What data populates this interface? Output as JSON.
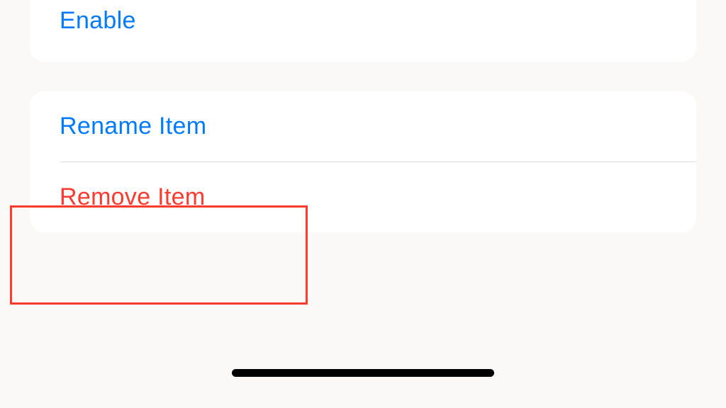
{
  "section1": {
    "enable_label": "Enable"
  },
  "section2": {
    "rename_label": "Rename Item",
    "remove_label": "Remove Item"
  }
}
